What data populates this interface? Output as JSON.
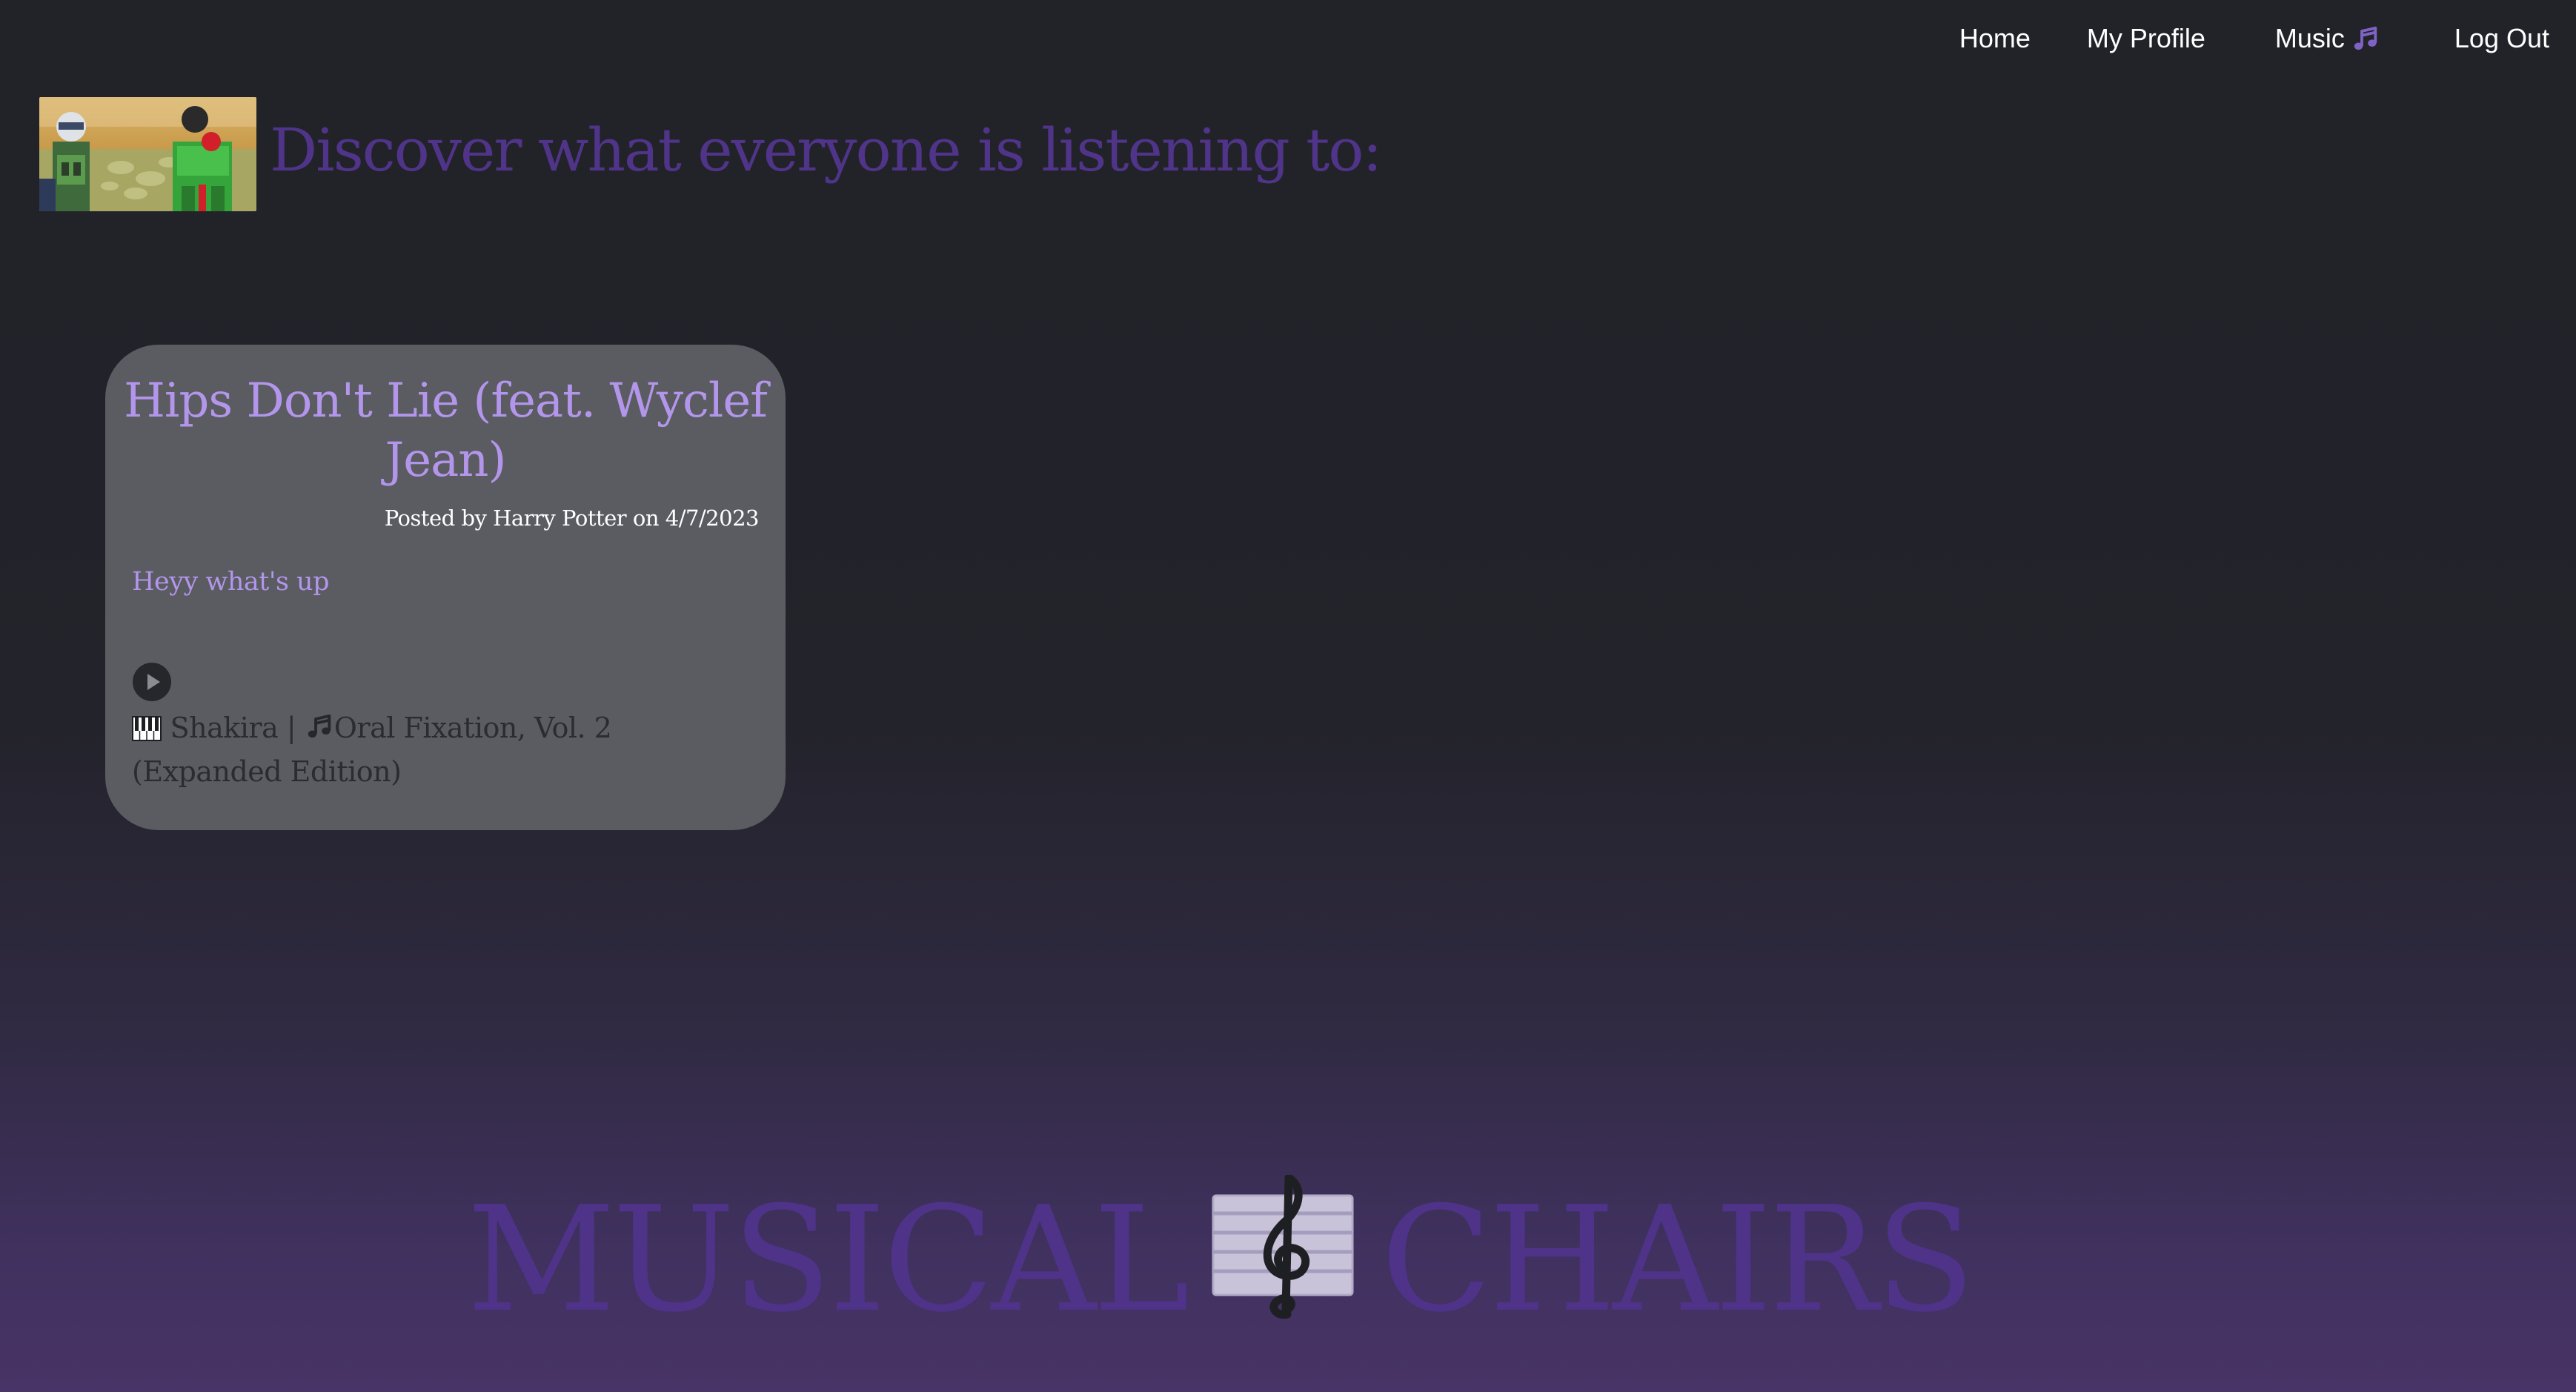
{
  "nav": {
    "home": "Home",
    "profile": "My Profile",
    "music": "Music",
    "logout": "Log Out",
    "music_icon": "music-note-icon"
  },
  "header": {
    "title": "Discover what everyone is listening to:"
  },
  "post": {
    "song_title": "Hips Don't Lie (feat. Wyclef Jean)",
    "meta": "Posted by Harry Potter on 4/7/2023",
    "body": "Heyy what's up",
    "artist": "Shakira",
    "separator": "|",
    "album": "Oral Fixation, Vol. 2 (Expanded Edition)",
    "play_icon": "play-icon",
    "artist_icon": "piano-keys-icon",
    "album_icon": "music-note-icon"
  },
  "footer": {
    "brand_left": "MUSICAL",
    "brand_right": "CHAIRS",
    "logo_icon": "sheet-music-treble-clef-icon"
  },
  "colors": {
    "accent": "#50348a",
    "song_title": "#b396eb",
    "card_bg": "#5a5c61",
    "page_bg": "#212328"
  }
}
